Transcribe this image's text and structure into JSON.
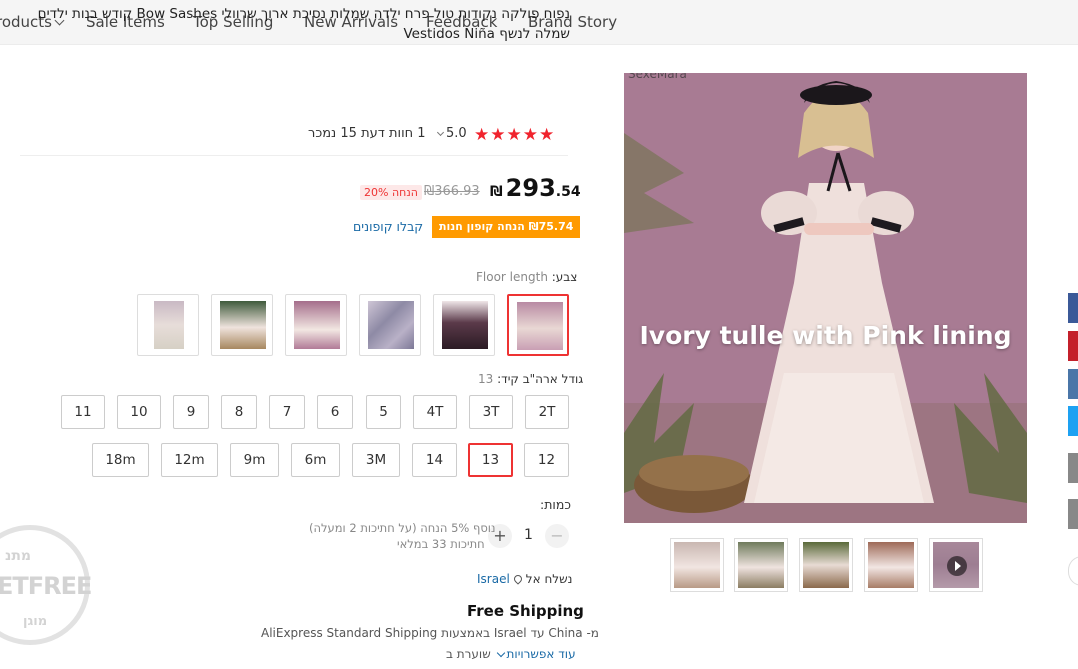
{
  "nav": {
    "items": [
      {
        "label": "roducts",
        "has_dropdown": true
      },
      {
        "label": "Sale Items"
      },
      {
        "label": "Top Selling"
      },
      {
        "label": "New Arrivals"
      },
      {
        "label": "Feedback"
      },
      {
        "label": "Brand Story"
      }
    ]
  },
  "product": {
    "title": "נפוח פולקה נקודות טול פרח ילדה שמלות נסיכת ארוך שרוולי Bow Sashes קודש בנות ילדים שמלה לנשף Vestidos Niña",
    "rating": {
      "stars": "★★★★★",
      "value": "5.0",
      "review_text": "1 חוות דעת  15 נמכר"
    },
    "price": {
      "currency": "₪",
      "integer": "293",
      "decimal": ".54",
      "old": "₪366.93",
      "discount": "הנחה 20%"
    },
    "coupon": {
      "badge": "₪75.74 הנחה קופון חנות",
      "link": "קבלו קופונים"
    },
    "color": {
      "label": "צבע:",
      "selected": "Floor length"
    },
    "size": {
      "label": "גודל ארה\"ב קיד:",
      "selected": "13",
      "row1": [
        "11",
        "10",
        "9",
        "8",
        "7",
        "6",
        "5",
        "4T",
        "3T",
        "2T"
      ],
      "row2": [
        "18m",
        "12m",
        "9m",
        "6m",
        "3M",
        "14",
        "13",
        "12"
      ]
    },
    "quantity": {
      "label": "כמות:",
      "value": "1",
      "minus": "−",
      "plus": "+",
      "note1": "נוסף 5% הנחה (על חתיכות 2 ומעלה)",
      "note2": "חתיכות 33 במלאי"
    },
    "shipping": {
      "ship_to_label": "נשלח אל",
      "country": "Israel",
      "free_title": "Free Shipping",
      "detail": "מ- China עד Israel באמצעות AliExpress Standard Shipping",
      "more_link": "עוד אפשרויות",
      "more_suffix": "שוערת ב"
    },
    "stamp": {
      "top": "מתנ",
      "mid": "ETFREE",
      "bottom": "מוגן"
    }
  },
  "gallery": {
    "watermark": "SexeMara",
    "overlay": "Ivory tulle with Pink lining"
  },
  "colors": {
    "accent": "#e33333",
    "coupon": "#ff9a00",
    "link": "#1a6aa6",
    "stars": "#f0232d"
  }
}
